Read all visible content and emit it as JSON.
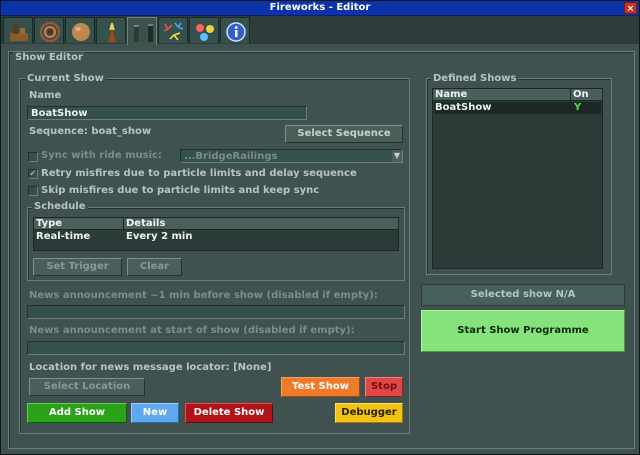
{
  "window": {
    "title": "Fireworks - Editor",
    "close_glyph": "×"
  },
  "tabs": [
    {
      "icon": "launcher-icon"
    },
    {
      "icon": "rings-icon"
    },
    {
      "icon": "ball-shell-icon"
    },
    {
      "icon": "fountain-icon"
    },
    {
      "icon": "mortar-icon"
    },
    {
      "icon": "burst-icon"
    },
    {
      "icon": "multi-burst-icon"
    },
    {
      "icon": "info-icon"
    }
  ],
  "show_editor": {
    "group_label": "Show Editor",
    "current_show": {
      "group_label": "Current Show",
      "name_label": "Name",
      "name_value": "BoatShow",
      "sequence_label": "Sequence: boat_show",
      "select_sequence_label": "Select Sequence",
      "sync_label": "Sync with ride music:",
      "sync_dropdown_value": "...BridgeRailings",
      "retry_label": "Retry misfires due to particle limits and delay sequence",
      "skip_label": "Skip misfires due to particle limits and keep sync"
    },
    "schedule": {
      "group_label": "Schedule",
      "columns": [
        "Type",
        "Details"
      ],
      "rows": [
        [
          "Real-time",
          "Every 2 min"
        ]
      ],
      "set_trigger_label": "Set Trigger",
      "clear_label": "Clear"
    },
    "news_before_label": "News announcement ~1 min before show (disabled if empty):",
    "news_start_label": "News announcement at start of show (disabled if empty):",
    "location_label": "Location for news message locator: [None]",
    "select_location_label": "Select Location",
    "test_show_label": "Test Show",
    "stop_label": "Stop",
    "add_show_label": "Add Show",
    "new_label": "New",
    "delete_show_label": "Delete Show",
    "debugger_label": "Debugger",
    "defined_shows": {
      "group_label": "Defined Shows",
      "columns": [
        "Name",
        "On"
      ],
      "rows": [
        [
          "BoatShow",
          "Y"
        ]
      ]
    },
    "selected_show_label": "Selected show N/A",
    "start_programme_label": "Start Show Programme"
  },
  "colors": {
    "add_show": "#2aa21a",
    "new": "#5ea8ee",
    "delete_show": "#b0141a",
    "test_show": "#f07a2a",
    "stop": "#e04848",
    "debugger": "#f2c214",
    "start_programme": "#86e27a",
    "on_flag": "#4fe04f"
  }
}
